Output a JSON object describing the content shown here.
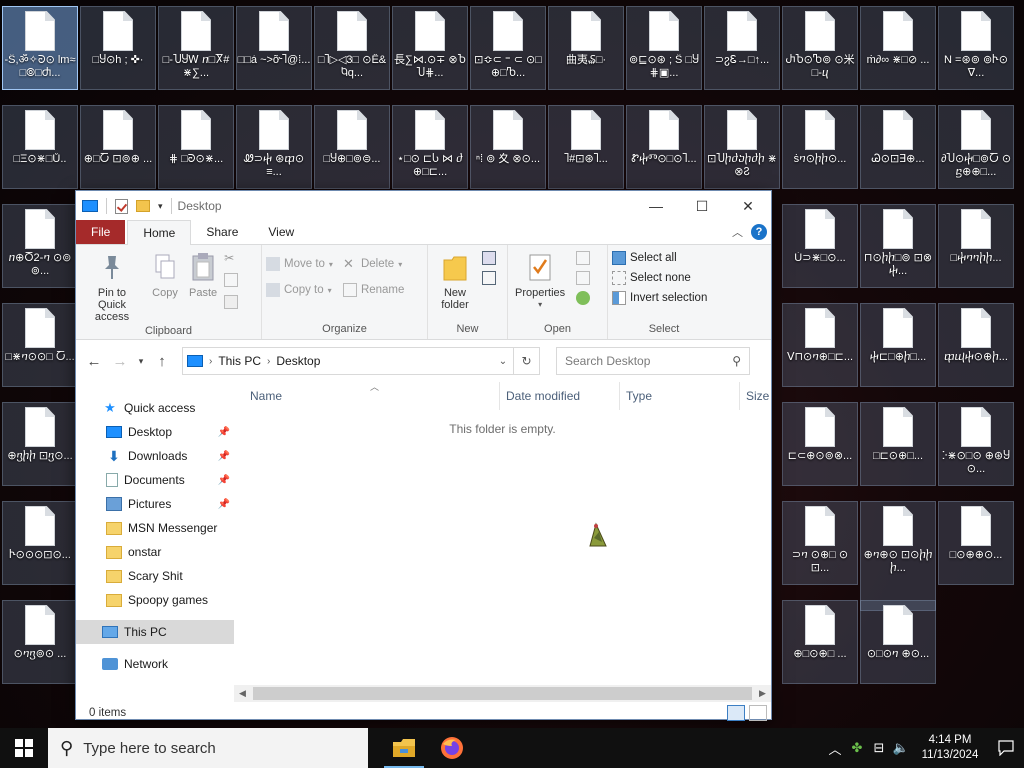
{
  "desktop": {
    "icons": [
      {
        "label": "-Ŝ,ॐ✧ᘒ⊙ lm≈□⦾□Ⴛ..."
      },
      {
        "label": "□Ⴘ⊙h ; ✜·"
      },
      {
        "label": "□-ႮႸᎳ ⴖ□Ⴟ#⋇∑..."
      },
      {
        "label": "□□ẚ ~>ỡ᠊Ⴈ@⁞..."
      },
      {
        "label": "□Ⴈ▷◁3□ ⊙Ế&Ⴉq..."
      },
      {
        "label": "長∑⋈.⊙∓ ⊗ႦႮ⋕..."
      },
      {
        "label": "⊡≎⊂ ⁼ ⊂ ⊙□⊕□Ⴊ..."
      },
      {
        "label": "曲夷₷□·"
      },
      {
        "label": "⊚⊑⊙⊛ ; Ŝ □Ⴘ⋕▣..."
      },
      {
        "label": "⊃ⴧᏋ→□↑..."
      },
      {
        "label": "ႰႦ⊙Ⴊ⊚ ⊙米□-ⴗ"
      },
      {
        "label": "ṁ∂∞ ⋇□⊘ ..."
      },
      {
        "label": "Ν =⊛⊚ ⊚Ⴡ⊙∇..."
      },
      {
        "label": "□Ξ⊙⋇□Ů.."
      },
      {
        "label": "⊕□Ⴀ ⊡⊚⊕ ..."
      },
      {
        "label": "⋕ □ᘒ⊙⋇..."
      },
      {
        "label": "Ꮺ⊃ⴕ ⊛ⴔ⊙≡..."
      },
      {
        "label": "□Ⴘ⊕□⊚⊜..."
      },
      {
        "label": "⋆□⊙ ⊏Ⴑ ⋈ ⴛ ⊕□⊏..."
      },
      {
        "label": "ⁿ⁞ ⊚ 夊 ⊗⊙..."
      },
      {
        "label": "Ⴈ#⊡⊛Ⴈ..."
      },
      {
        "label": "ᏑⴕⰕ⊙□⊙Ⴈ..."
      },
      {
        "label": "⊡Ⴎⴙⴛⴢⴙⴛⴙ ⋇⊗Ⴧ"
      },
      {
        "label": "ṡⴈ⊙ⴙⴙ⊙..."
      },
      {
        "label": "Ꮚ⊙⊡∃⊕..."
      },
      {
        "label": "∂Ⴎ⊙ⴕ□⊚Ⴀ ⊙ⴝ⊕⊕□..."
      },
      {
        "label": "ⴖ⊕Ⴃ2-ⴈ ⊙⊚⊚..."
      },
      {
        "label": "Ủ⊃⋇□⊙..."
      },
      {
        "label": "⊓⊙ⴙⴙ□⊚ ⊡⊗ⴕ..."
      },
      {
        "label": "□ⴕⴈⴈⴙⴙ..."
      },
      {
        "label": "□⋇ⴈ⊙⊙□ Ⴀ..."
      },
      {
        "label": "ⴸ⊓⊙ⴈ⊕□⊏..."
      },
      {
        "label": "ⴕ⊏□⊕ⴙ□..."
      },
      {
        "label": "ⴔⴓⴕ⊙⊕ⴙ..."
      },
      {
        "label": "⊕ⴂⴙⴙ ⊡ⴂ⊙..."
      },
      {
        "label": "⊏⊂⊕⊙⊚⊗..."
      },
      {
        "label": "□⊏⊙⊕□..."
      },
      {
        "label": "ⴾ⋇⊙□⊙ ⊕⊛Ⴘ⊙..."
      },
      {
        "label": "Ⴡ⊙⊙⊙⊡⊙..."
      },
      {
        "label": "⊃ⴈ ⊙⊕□ ⊙⊡..."
      },
      {
        "label": "⊕ⴈ⊕⊙ ⊡⊙ⴙⴙⴙ..."
      },
      {
        "label": "□⊙⊕⊕⊙..."
      },
      {
        "label": "⊙ⴈⴂ⊚⊙ ..."
      },
      {
        "label": "⊕□⊙⊕□ ..."
      },
      {
        "label": "⊙□⊙ⴈ ⊕⊙..."
      }
    ]
  },
  "window": {
    "title": "Desktop",
    "buttons": {
      "minimize": "—",
      "maximize": "☐",
      "close": "✕"
    }
  },
  "ribbon": {
    "tabs": [
      {
        "label": "File"
      },
      {
        "label": "Home"
      },
      {
        "label": "Share"
      },
      {
        "label": "View"
      }
    ],
    "clipboard": {
      "pin_label": "Pin to Quick access",
      "copy_label": "Copy",
      "paste_label": "Paste",
      "group_label": "Clipboard"
    },
    "organize": {
      "move_to": "Move to",
      "copy_to": "Copy to",
      "delete": "Delete",
      "rename": "Rename",
      "group_label": "Organize"
    },
    "new": {
      "new_folder": "New folder",
      "group_label": "New"
    },
    "open": {
      "properties": "Properties",
      "group_label": "Open"
    },
    "select": {
      "select_all": "Select all",
      "select_none": "Select none",
      "invert_selection": "Invert selection",
      "group_label": "Select"
    }
  },
  "address": {
    "root": "This PC",
    "current": "Desktop",
    "search_placeholder": "Search Desktop"
  },
  "navpane": {
    "quick_access": "Quick access",
    "items": [
      {
        "label": "Desktop",
        "pinned": true
      },
      {
        "label": "Downloads",
        "pinned": true
      },
      {
        "label": "Documents",
        "pinned": true
      },
      {
        "label": "Pictures",
        "pinned": true
      },
      {
        "label": "MSN Messenger",
        "pinned": false
      },
      {
        "label": "onstar",
        "pinned": false
      },
      {
        "label": "Scary Shit",
        "pinned": false
      },
      {
        "label": "Spoopy games",
        "pinned": false
      }
    ],
    "this_pc": "This PC",
    "network": "Network"
  },
  "filelist": {
    "columns": [
      {
        "label": "Name"
      },
      {
        "label": "Date modified"
      },
      {
        "label": "Type"
      },
      {
        "label": "Size"
      }
    ],
    "empty_message": "This folder is empty."
  },
  "status": {
    "item_count": "0 items"
  },
  "taskbar": {
    "search_placeholder": "Type here to search",
    "time": "4:14 PM",
    "date": "11/13/2024"
  }
}
